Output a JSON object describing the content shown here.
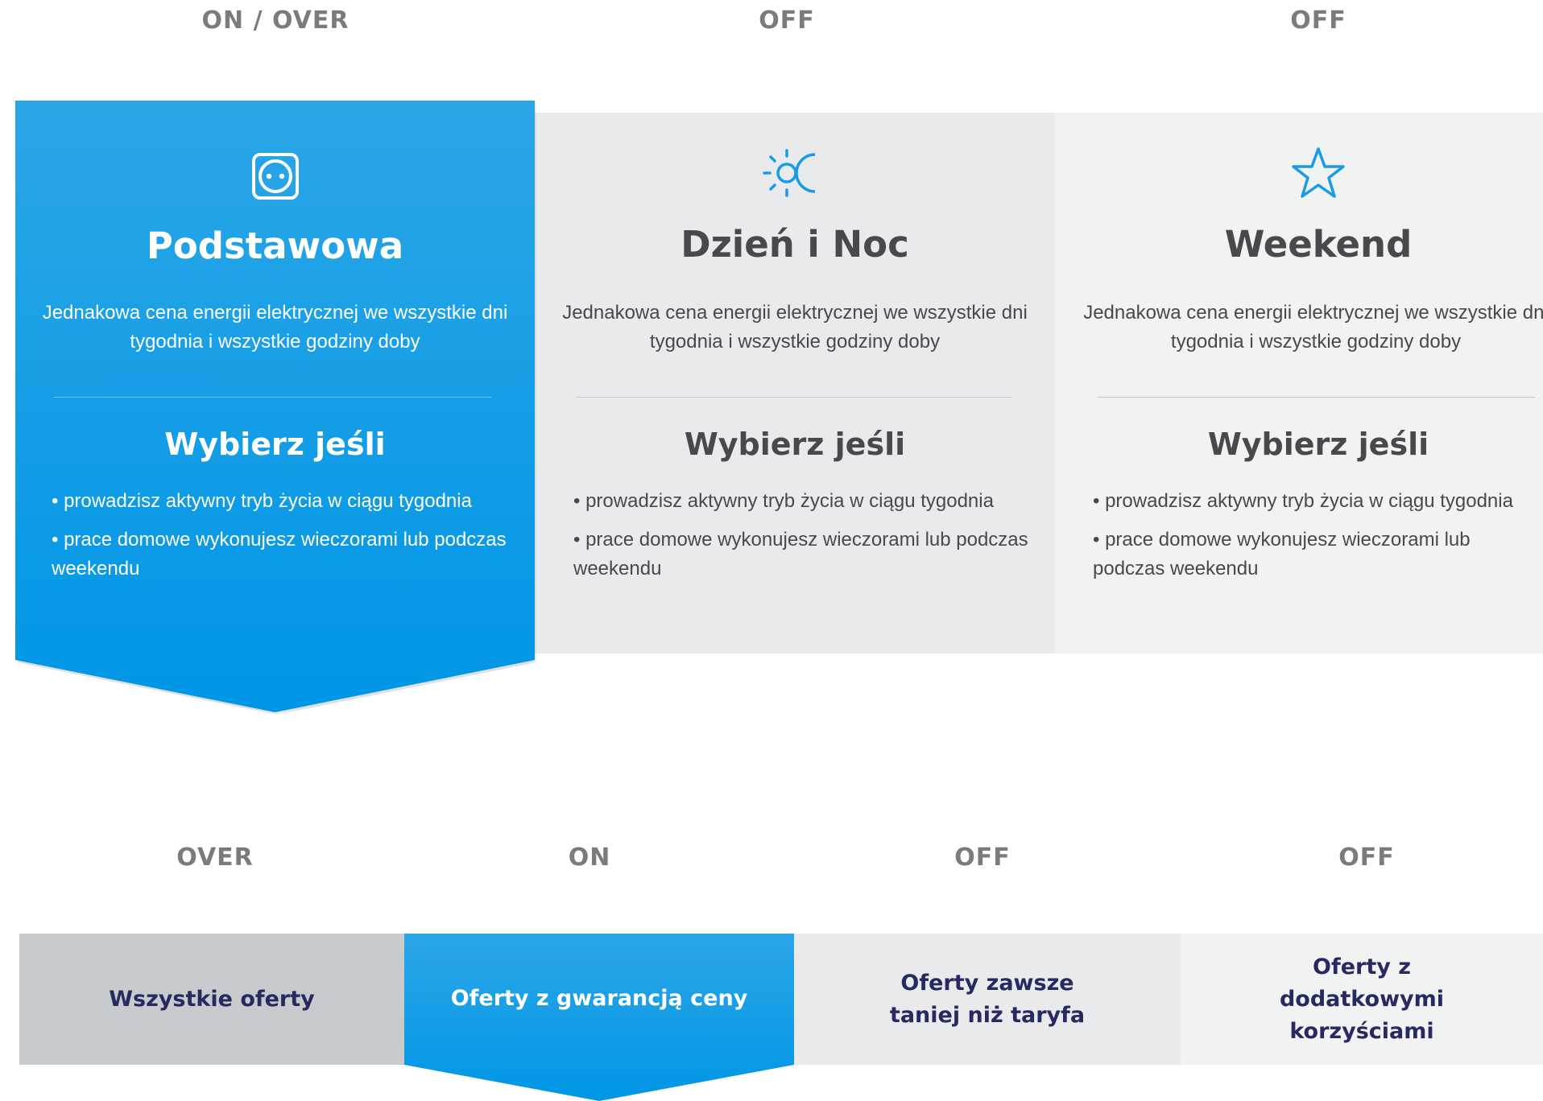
{
  "top_states": [
    "ON / OVER",
    "OFF",
    "OFF"
  ],
  "bottom_states": [
    "OVER",
    "ON",
    "OFF",
    "OFF"
  ],
  "colors": {
    "active_blue_top": "#2ba6e7",
    "active_blue_bottom": "#0096e6",
    "icon_blue": "#1a9be6",
    "off_bg_1": "#e9eaec",
    "off_bg_2": "#f1f2f2",
    "over_bg": "#c8cbce",
    "tab_text_navy": "#272a61",
    "card_text_gray": "#47494c",
    "state_label_gray": "#7a7b7d"
  },
  "cards": [
    {
      "icon": "power-socket-icon",
      "title": "Podstawowa",
      "description": "Jednakowa cena energii elektrycznej we wszystkie dni tygodnia i wszystkie godziny doby",
      "choose_heading": "Wybierz jeśli",
      "bullets": [
        "• prowadzisz aktywny tryb życia w ciągu tygodnia",
        "• prace domowe wykonujesz wieczorami lub podczas weekendu"
      ]
    },
    {
      "icon": "sun-moon-icon",
      "title": "Dzień i Noc",
      "description": "Jednakowa cena energii elektrycznej we wszystkie dni tygodnia i wszystkie godziny doby",
      "choose_heading": "Wybierz jeśli",
      "bullets": [
        "• prowadzisz aktywny tryb życia w ciągu tygodnia",
        "• prace domowe wykonujesz wieczorami lub podczas weekendu"
      ]
    },
    {
      "icon": "star-icon",
      "title": "Weekend",
      "description": "Jednakowa cena energii elektrycznej we wszystkie dni tygodnia i wszystkie godziny doby",
      "choose_heading": "Wybierz jeśli",
      "bullets": [
        "• prowadzisz aktywny tryb życia w ciągu tygodnia",
        "• prace domowe wykonujesz wieczorami lub podczas weekendu"
      ]
    }
  ],
  "tabs": [
    "Wszystkie oferty",
    "Oferty z gwarancją ceny",
    "Oferty zawsze taniej niż taryfa",
    "Oferty z dodatkowymi korzyściami"
  ]
}
